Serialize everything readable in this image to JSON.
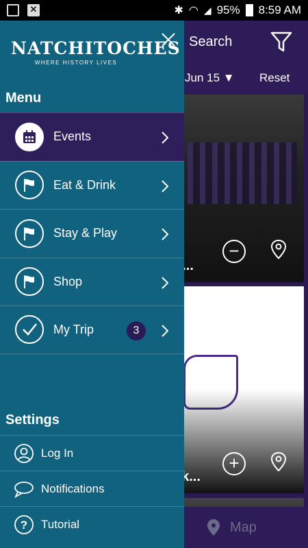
{
  "status_bar": {
    "battery": "95%",
    "time": "8:59 AM"
  },
  "background": {
    "search_label": "Search",
    "date_label": "Jun 15",
    "reset_label": "Reset",
    "cards": [
      {
        "title": "n..."
      },
      {
        "title": "sk..."
      }
    ],
    "bottom_tab": "Map"
  },
  "drawer": {
    "brand": {
      "name": "NATCHITOCHES",
      "tagline": "WHERE HISTORY LIVES"
    },
    "menu_title": "Menu",
    "menu": [
      {
        "label": "Events",
        "icon": "calendar-icon",
        "active": true
      },
      {
        "label": "Eat & Drink",
        "icon": "flag-icon"
      },
      {
        "label": "Stay & Play",
        "icon": "flag-icon"
      },
      {
        "label": "Shop",
        "icon": "flag-icon"
      },
      {
        "label": "My Trip",
        "icon": "checkmark-icon",
        "badge": "3"
      }
    ],
    "settings_title": "Settings",
    "settings": [
      {
        "label": "Log In",
        "icon": "user-icon"
      },
      {
        "label": "Notifications",
        "icon": "chat-bubble-icon"
      },
      {
        "label": "Tutorial",
        "icon": "help-icon"
      }
    ]
  },
  "colors": {
    "drawer_bg": "#11627f",
    "active_bg": "#2e1f5a",
    "app_purple": "#2d1c57",
    "badge_bg": "#2a1b57"
  }
}
